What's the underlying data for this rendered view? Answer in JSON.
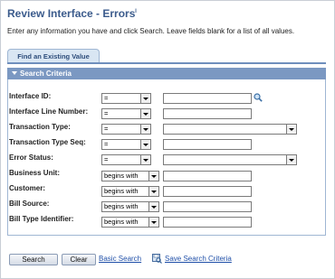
{
  "page": {
    "title": "Review Interface - Errors",
    "title_mark": "ˡ",
    "instructions": "Enter any information you have and click Search. Leave fields blank for a list of all values."
  },
  "tab": {
    "label": "Find an Existing Value"
  },
  "panel": {
    "header": "Search Criteria"
  },
  "fields": [
    {
      "label": "Interface ID:",
      "operator": "=",
      "value": "",
      "control": "lookup-input"
    },
    {
      "label": "Interface Line Number:",
      "operator": "=",
      "value": "",
      "control": "input"
    },
    {
      "label": "Transaction Type:",
      "operator": "=",
      "value": "",
      "control": "dropdown"
    },
    {
      "label": "Transaction Type Seq:",
      "operator": "=",
      "value": "",
      "control": "input"
    },
    {
      "label": "Error Status:",
      "operator": "=",
      "value": "",
      "control": "dropdown"
    },
    {
      "label": "Business Unit:",
      "operator": "begins with",
      "value": "",
      "control": "input"
    },
    {
      "label": "Customer:",
      "operator": "begins with",
      "value": "",
      "control": "input"
    },
    {
      "label": "Bill Source:",
      "operator": "begins with",
      "value": "",
      "control": "input"
    },
    {
      "label": "Bill Type Identifier:",
      "operator": "begins with",
      "value": "",
      "control": "input"
    }
  ],
  "actions": {
    "search_label": "Search",
    "clear_label": "Clear",
    "basic_search_label": "Basic Search",
    "save_criteria_label": "Save Search Criteria"
  },
  "colors": {
    "title": "#3b5b8c",
    "panel_header": "#7b98c2",
    "link": "#1f4fa8"
  },
  "icons": [
    "lookup-magnifier-icon",
    "dropdown-arrow-icon",
    "save-search-icon",
    "collapse-triangle-icon"
  ]
}
